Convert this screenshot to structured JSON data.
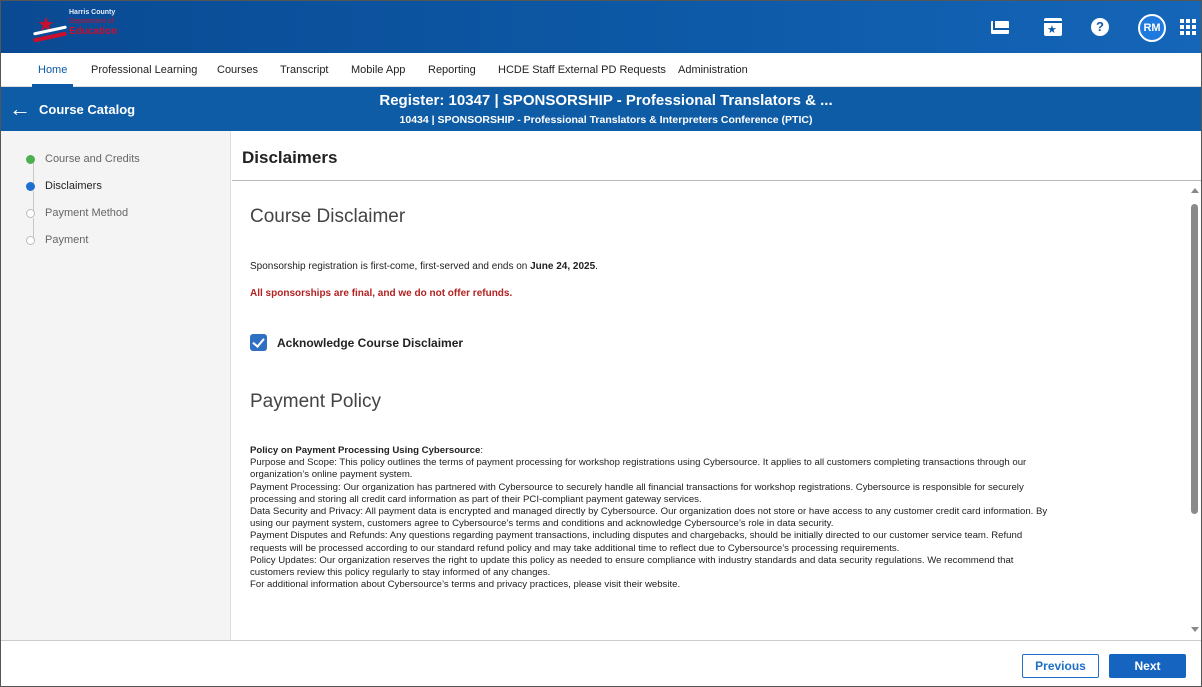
{
  "brand": {
    "line1": "Harris County",
    "line2": "Department of",
    "line3": "Education",
    "red": "#c8102e",
    "blue": "#0d5aa8"
  },
  "header": {
    "icons": [
      "mail-icon",
      "calendar-icon",
      "help-icon"
    ],
    "avatar_initials": "RM"
  },
  "nav": {
    "items": [
      {
        "label": "Home",
        "active": true
      },
      {
        "label": "Professional Learning"
      },
      {
        "label": "Courses"
      },
      {
        "label": "Transcript"
      },
      {
        "label": "Mobile App"
      },
      {
        "label": "Reporting"
      },
      {
        "label": "HCDE Staff External PD Requests"
      },
      {
        "label": "Administration"
      }
    ]
  },
  "titlebar": {
    "back_label": "Course Catalog",
    "title": "Register: 10347 | SPONSORSHIP - Professional Translators & ...",
    "subtitle": "10434 | SPONSORSHIP - Professional Translators & Interpreters Conference (PTIC)"
  },
  "steps": [
    {
      "label": "Course and Credits",
      "state": "complete"
    },
    {
      "label": "Disclaimers",
      "state": "current"
    },
    {
      "label": "Payment Method",
      "state": "pending"
    },
    {
      "label": "Payment",
      "state": "pending"
    }
  ],
  "main": {
    "heading": "Disclaimers",
    "course_disclaimer": {
      "title": "Course Disclaimer",
      "text_prefix": "Sponsorship registration is first-come, first-served and ends on ",
      "text_date": "June 24, 2025",
      "text_suffix": ".",
      "final_notice": "All sponsorships are final, and we do not offer refunds.",
      "acknowledge_label": "Acknowledge Course Disclaimer",
      "acknowledged": true
    },
    "payment_policy": {
      "title": "Payment Policy",
      "heading": "Policy on Payment Processing Using Cybersource",
      "heading_suffix": ":",
      "lines": [
        "Purpose and Scope: This policy outlines the terms of payment processing for workshop registrations using Cybersource. It applies to all customers completing transactions through our",
        "organization’s online payment system.",
        "Payment Processing: Our organization has partnered with Cybersource to securely handle all financial transactions for workshop registrations. Cybersource is responsible for securely",
        "processing and storing all credit card information as part of their PCI-compliant payment gateway services.",
        "Data Security and Privacy: All payment data is encrypted and managed directly by Cybersource. Our organization does not store or have access to any customer credit card information. By",
        "using our payment system, customers agree to Cybersource’s terms and conditions and acknowledge Cybersource’s role in data security.",
        "Payment Disputes and Refunds: Any questions regarding payment transactions, including disputes and chargebacks, should be initially directed to our customer service team. Refund",
        "requests will be processed according to our standard refund policy and may take additional time to reflect due to Cybersource’s processing requirements.",
        "Policy Updates: Our organization reserves the right to update this policy as needed to ensure compliance with industry standards and data security regulations. We recommend that",
        "customers review this policy regularly to stay informed of any changes.",
        "For additional information about Cybersource’s terms and privacy practices, please visit their website."
      ]
    }
  },
  "footer": {
    "previous_label": "Previous",
    "next_label": "Next"
  },
  "colors": {
    "step_complete": "#4caf50",
    "step_current": "#1f6fd0",
    "warning_red": "#b22222",
    "primary": "#1565c0"
  }
}
